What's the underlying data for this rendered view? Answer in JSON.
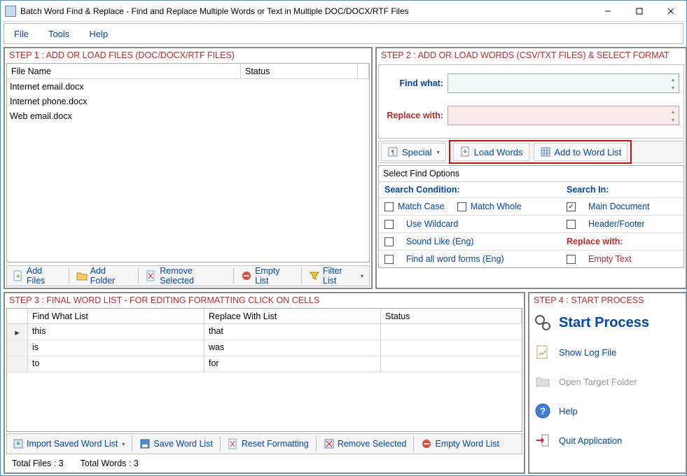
{
  "titlebar": {
    "text": "Batch Word Find & Replace - Find and Replace Multiple Words or Text  in Multiple DOC/DOCX/RTF Files"
  },
  "menu": {
    "file": "File",
    "tools": "Tools",
    "help": "Help"
  },
  "step1": {
    "title": "STEP 1 : ADD OR LOAD FILES (DOC/DOCX/RTF FILES)",
    "cols": {
      "filename": "File Name",
      "status": "Status"
    },
    "rows": [
      "Internet email.docx",
      "Internet phone.docx",
      "Web email.docx"
    ],
    "buttons": {
      "add": "Add Files",
      "addfolder": "Add Folder",
      "remove": "Remove Selected",
      "empty": "Empty List",
      "filter": "Filter List"
    }
  },
  "step2": {
    "title": "STEP 2 : ADD OR LOAD WORDS (CSV/TXT FILES) & SELECT FORMAT",
    "findwhat": "Find what:",
    "replacewith": "Replace with:",
    "buttons": {
      "special": "Special",
      "load": "Load Words",
      "addword": "Add to Word List"
    },
    "opts": {
      "title": "Select Find Options",
      "searchcond": "Search Condition:",
      "searchin": "Search In:",
      "matchcase": "Match Case",
      "matchwhole": "Match Whole",
      "wildcard": "Use Wildcard",
      "soundlike": "Sound Like (Eng)",
      "allforms": "Find all word forms (Eng)",
      "maindoc": "Main Document",
      "headerfooter": "Header/Footer",
      "replacewith": "Replace with:",
      "emptytext": "Empty Text"
    }
  },
  "step3": {
    "title": "STEP 3 : FINAL WORD LIST - FOR EDITING FORMATTING CLICK ON CELLS",
    "cols": {
      "find": "Find What List",
      "replace": "Replace With List",
      "status": "Status"
    },
    "rows": [
      {
        "find": "this",
        "replace": "that"
      },
      {
        "find": "is",
        "replace": "was"
      },
      {
        "find": "to",
        "replace": "for"
      }
    ],
    "buttons": {
      "import": "Import Saved Word List",
      "save": "Save Word List",
      "reset": "Reset Formatting",
      "remove": "Remove Selected",
      "empty": "Empty Word List"
    },
    "status": {
      "files": "Total Files : 3",
      "words": "Total Words : 3"
    }
  },
  "step4": {
    "title": "STEP 4 : START PROCESS",
    "start": "Start Process",
    "showlog": "Show Log File",
    "opentarget": "Open Target Folder",
    "help": "Help",
    "quit": "Quit Application"
  }
}
